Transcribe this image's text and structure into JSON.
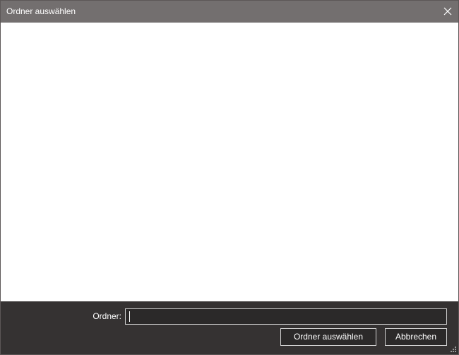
{
  "window": {
    "title": "Ordner auswählen"
  },
  "footer": {
    "folder_label": "Ordner:",
    "folder_value": "",
    "select_button": "Ordner auswählen",
    "cancel_button": "Abbrechen"
  },
  "icons": {
    "close": "close-icon",
    "resize": "resize-grip-icon"
  },
  "colors": {
    "titlebar": "#736f6f",
    "footer": "#353232",
    "content": "#ffffff"
  }
}
